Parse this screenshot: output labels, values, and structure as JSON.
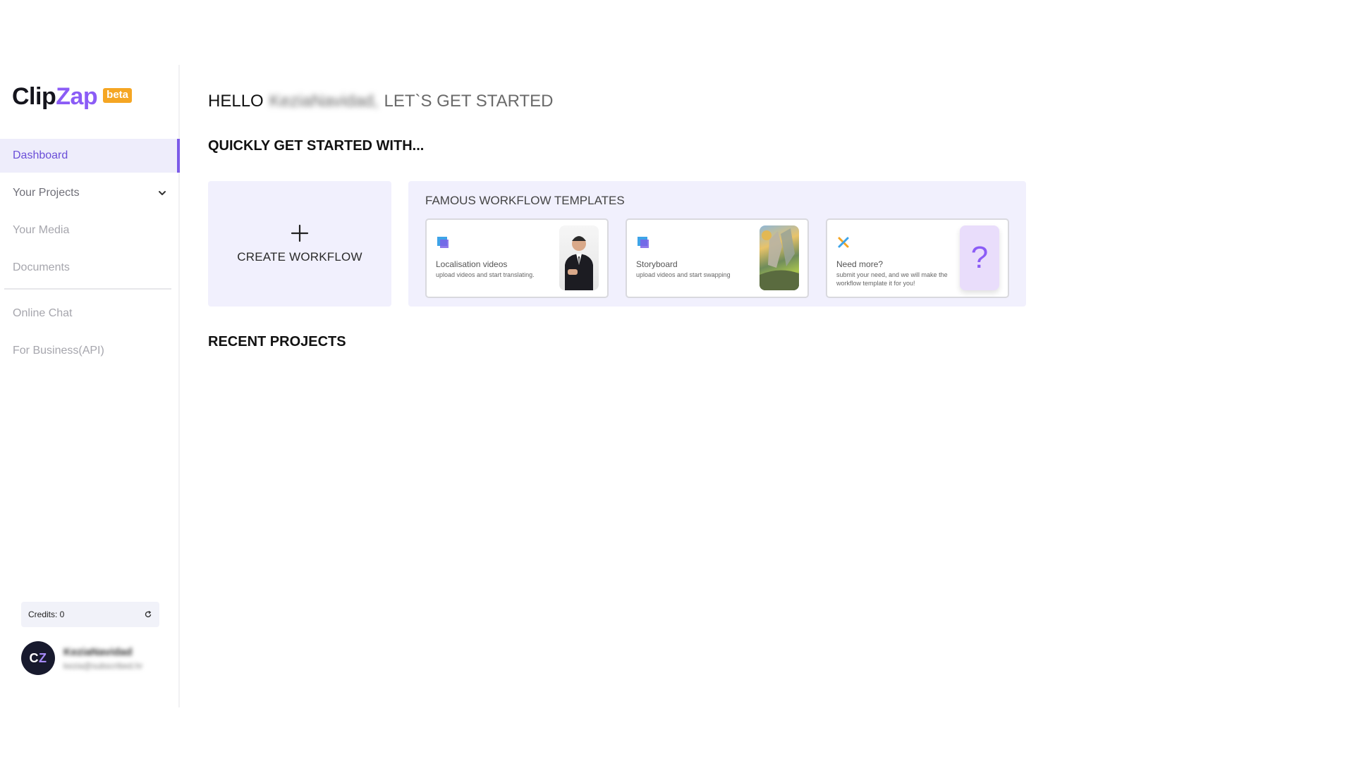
{
  "brand": {
    "name_part1": "Clip",
    "name_part2": "Zap",
    "badge": "beta"
  },
  "sidebar": {
    "items": [
      {
        "label": "Dashboard",
        "active": true
      },
      {
        "label": "Your Projects",
        "expandable": true
      },
      {
        "label": "Your Media"
      },
      {
        "label": "Documents"
      },
      {
        "label": "Online Chat"
      },
      {
        "label": "For Business(API)"
      }
    ],
    "credits_label": "Credits: 0",
    "user": {
      "initial_1": "C",
      "initial_2": "Z",
      "name": "KeziaNavidad",
      "email": "kezia@subscribed.hr"
    }
  },
  "header": {
    "hello": "HELLO",
    "name": "KeziaNavidad,",
    "rest": "LET`S GET STARTED"
  },
  "main": {
    "quick_title": "QUICKLY GET STARTED WITH...",
    "create_label": "CREATE WORKFLOW",
    "templates_title": "FAMOUS WORKFLOW TEMPLATES",
    "templates": [
      {
        "name": "Localisation videos",
        "desc": "upload videos and start translating."
      },
      {
        "name": "Storyboard",
        "desc": "upload videos and start swapping"
      },
      {
        "name": "Need more?",
        "desc": "submit your need, and we will make the workflow template it for you!"
      }
    ],
    "recent_title": "RECENT PROJECTS"
  },
  "colors": {
    "accent": "#8b5cf6",
    "active_bg": "#eeedfb",
    "card_bg": "#f1f0fd",
    "badge": "#f5a623"
  },
  "icons": {
    "chevron": "chevron-down-icon",
    "refresh": "refresh-icon",
    "plus": "plus-icon",
    "template_1": "video-translate-icon",
    "template_2": "storyboard-icon",
    "template_3": "tools-icon"
  }
}
